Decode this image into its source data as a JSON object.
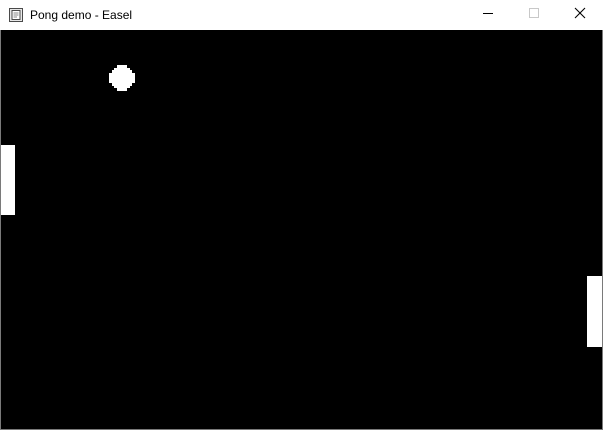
{
  "window": {
    "title": "Pong demo - Easel",
    "icon": "app-window-icon",
    "controls": {
      "minimize_icon": "minimize-icon",
      "maximize_icon": "maximize-icon",
      "close_icon": "close-icon"
    }
  },
  "game": {
    "background_color": "#000000",
    "foreground_color": "#ffffff",
    "objects": [
      "left-paddle",
      "right-paddle",
      "ball"
    ]
  }
}
